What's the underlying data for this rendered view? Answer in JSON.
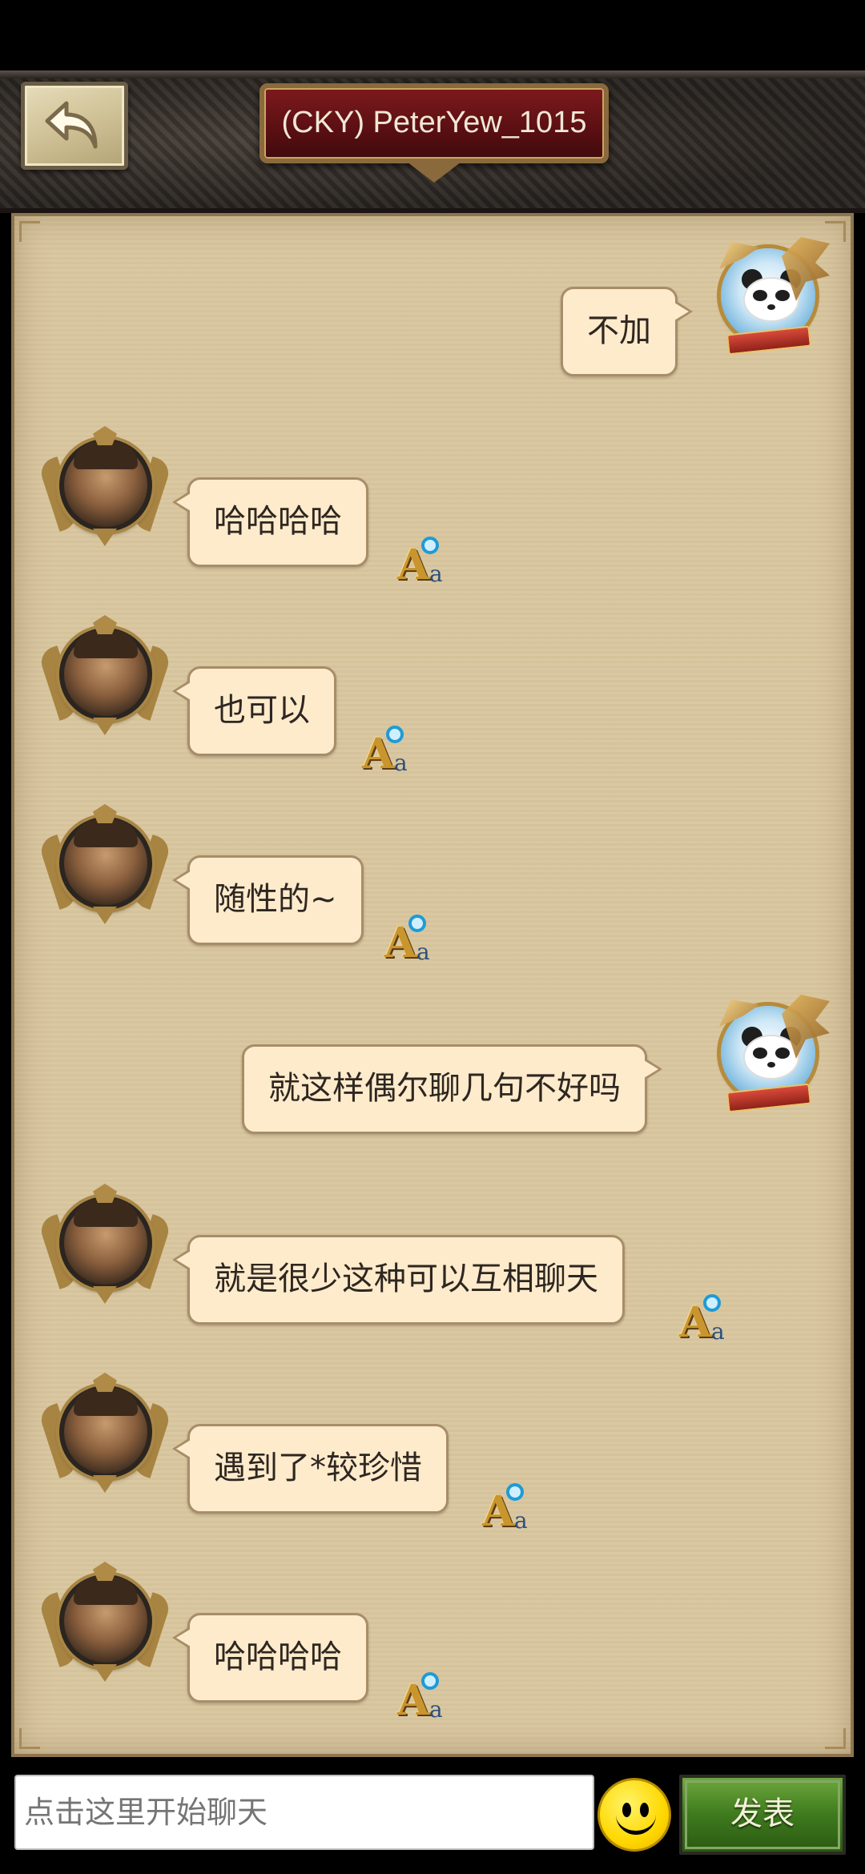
{
  "header": {
    "title": "(CKY) PeterYew_1015"
  },
  "messages": [
    {
      "side": "out",
      "text": "不加"
    },
    {
      "side": "in",
      "text": "哈哈哈哈"
    },
    {
      "side": "in",
      "text": "也可以"
    },
    {
      "side": "in",
      "text": "随性的~"
    },
    {
      "side": "out",
      "text": "就这样偶尔聊几句不好吗"
    },
    {
      "side": "in",
      "text": "就是很少这种可以互相聊天"
    },
    {
      "side": "in",
      "text": "遇到了*较珍惜"
    },
    {
      "side": "in",
      "text": "哈哈哈哈"
    }
  ],
  "translate_icon": {
    "big": "A",
    "small": "a"
  },
  "input": {
    "placeholder": "点击这里开始聊天"
  },
  "send_label": "发表",
  "icons": {
    "back": "back-arrow-icon",
    "emoji": "smiley-icon",
    "translate": "translate-icon"
  },
  "colors": {
    "panel_bg": "#d9c7a0",
    "bubble_bg": "#fdebcc",
    "title_plate": "#7d1a1d",
    "send_button": "#4e8a28"
  }
}
